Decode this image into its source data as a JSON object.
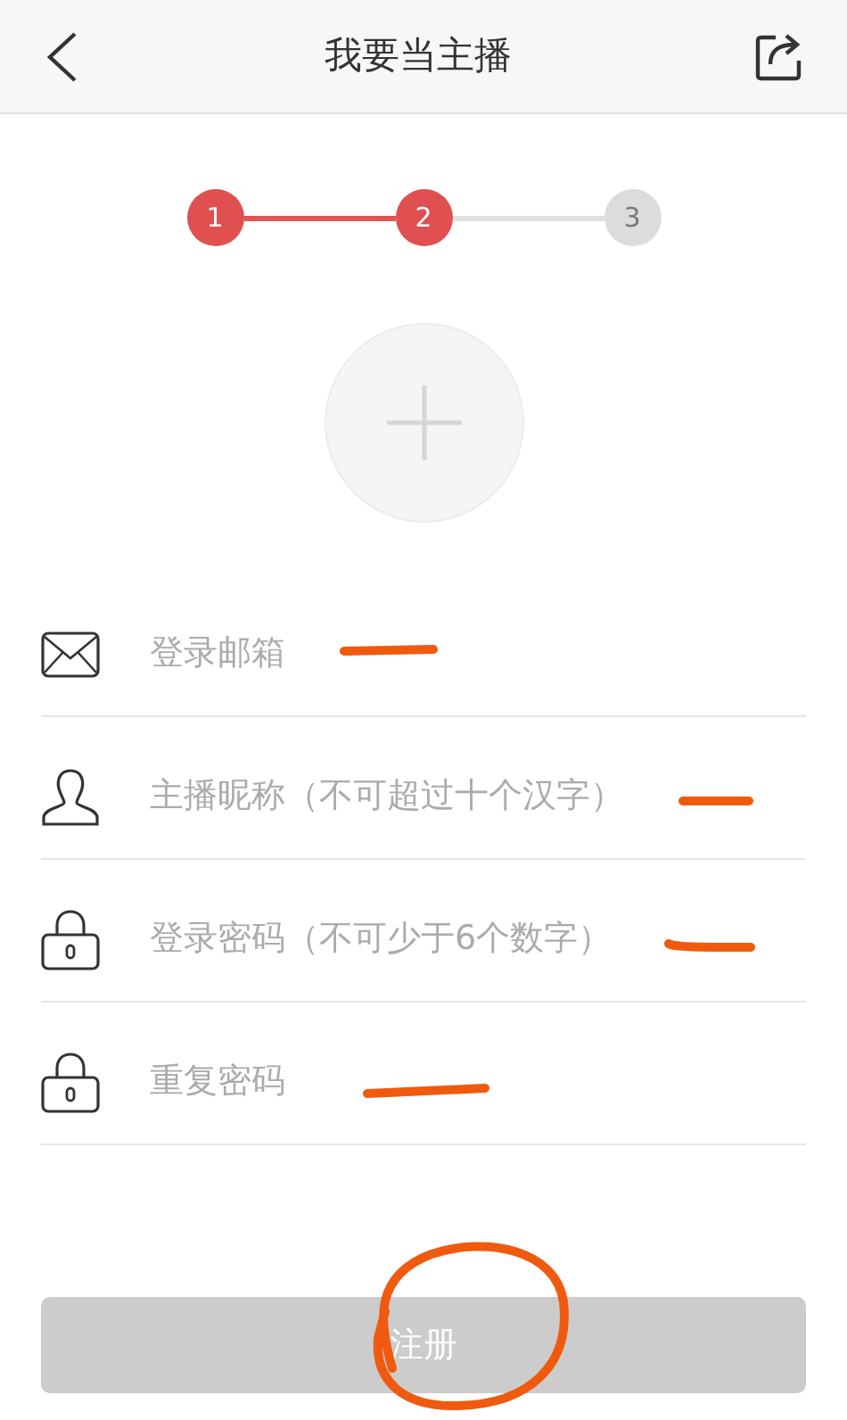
{
  "header": {
    "title": "我要当主播"
  },
  "steps": [
    {
      "label": "1",
      "active": true
    },
    {
      "label": "2",
      "active": true
    },
    {
      "label": "3",
      "active": false
    }
  ],
  "fields": [
    {
      "kind": "email",
      "placeholder": "登录邮箱"
    },
    {
      "kind": "user",
      "placeholder": "主播昵称（不可超过十个汉字）"
    },
    {
      "kind": "lock",
      "placeholder": "登录密码（不可少于6个数字）"
    },
    {
      "kind": "lock",
      "placeholder": "重复密码"
    }
  ],
  "submit": {
    "label": "注册",
    "disabled": true
  }
}
